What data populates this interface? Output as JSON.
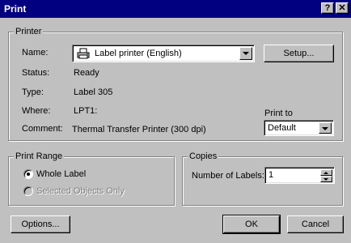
{
  "window": {
    "title": "Print",
    "help_button": "?",
    "close_button": "✕"
  },
  "printer": {
    "group_label": "Printer",
    "name_label": "Name:",
    "name_value": "Label printer (English)",
    "name_icon": "printer-icon",
    "setup_label": "Setup...",
    "status_label": "Status:",
    "status_value": "Ready",
    "type_label": "Type:",
    "type_value": "Label 305",
    "where_label": "Where:",
    "where_value": "LPT1:",
    "comment_label": "Comment:",
    "comment_value": "Thermal Transfer Printer (300 dpi)",
    "print_to_label": "Print to",
    "print_to_value": "Default"
  },
  "print_range": {
    "group_label": "Print Range",
    "whole_label": "Whole Label",
    "whole_checked": true,
    "selected_objects": "Selected Objects Only",
    "selected_enabled": false
  },
  "copies": {
    "group_label": "Copies",
    "number_label": "Number of Labels:",
    "number_value": "1"
  },
  "buttons": {
    "options": "Options...",
    "ok": "OK",
    "cancel": "Cancel"
  },
  "colors": {
    "titlebar": "#000080",
    "face": "#c0c0c0"
  }
}
